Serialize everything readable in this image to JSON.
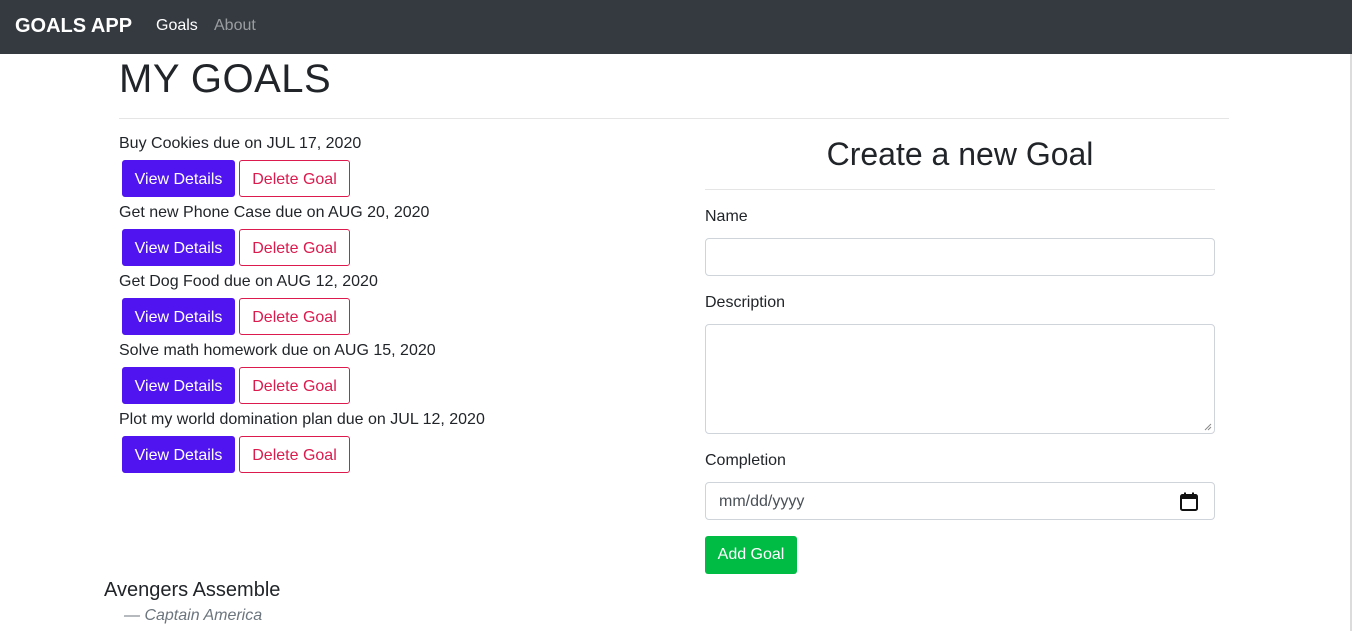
{
  "navbar": {
    "brand": "GOALS APP",
    "links": [
      {
        "label": "Goals",
        "active": true
      },
      {
        "label": "About",
        "active": false
      }
    ]
  },
  "page": {
    "title": "MY GOALS"
  },
  "goals": [
    {
      "text": "Buy Cookies due on JUL 17, 2020",
      "view_label": "View Details",
      "delete_label": "Delete Goal"
    },
    {
      "text": "Get new Phone Case due on AUG 20, 2020",
      "view_label": "View Details",
      "delete_label": "Delete Goal"
    },
    {
      "text": "Get Dog Food due on AUG 12, 2020",
      "view_label": "View Details",
      "delete_label": "Delete Goal"
    },
    {
      "text": "Solve math homework due on AUG 15, 2020",
      "view_label": "View Details",
      "delete_label": "Delete Goal"
    },
    {
      "text": "Plot my world domination plan due on JUL 12, 2020",
      "view_label": "View Details",
      "delete_label": "Delete Goal"
    }
  ],
  "form": {
    "title": "Create a new Goal",
    "name_label": "Name",
    "name_value": "",
    "description_label": "Description",
    "description_value": "",
    "completion_label": "Completion",
    "completion_placeholder": "mm/dd/yyyy",
    "submit_label": "Add Goal"
  },
  "quote": {
    "text": "Avengers Assemble",
    "author": "— Captain America"
  },
  "colors": {
    "navbar_bg": "#343a40",
    "primary_button": "#4f14f0",
    "danger_outline": "#dc1a4e",
    "success_button": "#00bb44"
  }
}
